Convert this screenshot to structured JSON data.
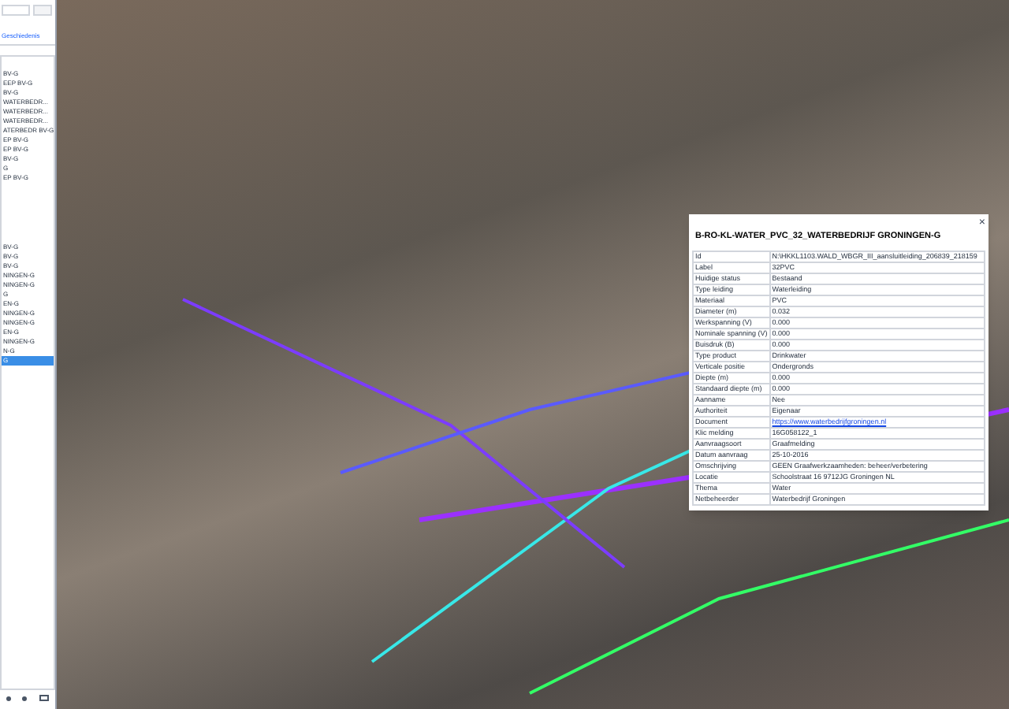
{
  "sidebar": {
    "tabs": [
      {
        "label": "Geschiedenis",
        "selected": false
      }
    ],
    "items": [
      {
        "label": "BV-G",
        "selected": false
      },
      {
        "label": "EEP BV-G",
        "selected": false
      },
      {
        "label": "BV-G",
        "selected": false
      },
      {
        "label": "WATERBEDR...",
        "selected": false
      },
      {
        "label": "WATERBEDR...",
        "selected": false
      },
      {
        "label": "WATERBEDR...",
        "selected": false
      },
      {
        "label": "ATERBEDR BV-G",
        "selected": false
      },
      {
        "label": "EP BV-G",
        "selected": false
      },
      {
        "label": "EP BV-G",
        "selected": false
      },
      {
        "label": "BV-G",
        "selected": false
      },
      {
        "label": "G",
        "selected": false
      },
      {
        "label": "EP BV-G",
        "selected": false
      },
      {
        "label": "BV-G",
        "selected": false
      },
      {
        "label": "BV-G",
        "selected": false
      },
      {
        "label": "BV-G",
        "selected": false
      },
      {
        "label": "NINGEN-G",
        "selected": false
      },
      {
        "label": "NINGEN-G",
        "selected": false
      },
      {
        "label": "G",
        "selected": false
      },
      {
        "label": "EN-G",
        "selected": false
      },
      {
        "label": "NINGEN-G",
        "selected": false
      },
      {
        "label": "NINGEN-G",
        "selected": false
      },
      {
        "label": "EN-G",
        "selected": false
      },
      {
        "label": "NINGEN-G",
        "selected": false
      },
      {
        "label": "N-G",
        "selected": false
      },
      {
        "label": "G",
        "selected": true
      }
    ]
  },
  "popup": {
    "close": "×",
    "title": "B-RO-KL-WATER_PVC_32_WATERBEDRIJF GRONINGEN-G",
    "rows": [
      {
        "key": "Id",
        "value": "N:\\HKKL1103.WALD_WBGR_III_aansluitleiding_206839_218159",
        "kind": "text"
      },
      {
        "key": "Label",
        "value": "32PVC",
        "kind": "text"
      },
      {
        "key": "Huidige status",
        "value": "Bestaand",
        "kind": "text"
      },
      {
        "key": "Type leiding",
        "value": "Waterleiding",
        "kind": "text"
      },
      {
        "key": "Materiaal",
        "value": "PVC",
        "kind": "text"
      },
      {
        "key": "Diameter (m)",
        "value": "0.032",
        "kind": "text"
      },
      {
        "key": "Werkspanning (V)",
        "value": "0.000",
        "kind": "text"
      },
      {
        "key": "Nominale spanning (V)",
        "value": "0.000",
        "kind": "text"
      },
      {
        "key": "Buisdruk (B)",
        "value": "0.000",
        "kind": "text"
      },
      {
        "key": "Type product",
        "value": "Drinkwater",
        "kind": "text"
      },
      {
        "key": "Verticale positie",
        "value": "Ondergronds",
        "kind": "text"
      },
      {
        "key": "Diepte (m)",
        "value": "0.000",
        "kind": "text"
      },
      {
        "key": "Standaard diepte (m)",
        "value": "0.000",
        "kind": "text"
      },
      {
        "key": "Aanname",
        "value": "Nee",
        "kind": "text"
      },
      {
        "key": "Authoriteit",
        "value": "Eigenaar",
        "kind": "text"
      },
      {
        "key": "Document",
        "value": "https://www.waterbedrijfgroningen.nl",
        "kind": "link"
      },
      {
        "key": "Klic melding",
        "value": "16G058122_1",
        "kind": "text"
      },
      {
        "key": "Aanvraagsoort",
        "value": "Graafmelding",
        "kind": "text"
      },
      {
        "key": "Datum aanvraag",
        "value": "25-10-2016",
        "kind": "text"
      },
      {
        "key": "Omschrijving",
        "value": "GEEN Graafwerkzaamheden: beheer/verbetering",
        "kind": "text"
      },
      {
        "key": "Locatie",
        "value": "Schoolstraat 16 9712JG Groningen NL",
        "kind": "text"
      },
      {
        "key": "Thema",
        "value": "Water",
        "kind": "text"
      },
      {
        "key": "Netbeheerder",
        "value": "Waterbedrijf Groningen",
        "kind": "text"
      }
    ]
  }
}
